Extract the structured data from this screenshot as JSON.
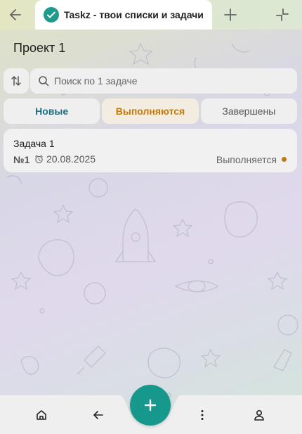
{
  "window": {
    "tab_title": "Taskz - твои списки и задачи",
    "logo_text": "Taskz",
    "accent": "#17988c"
  },
  "page": {
    "title": "Проект 1"
  },
  "search": {
    "placeholder": "Поиск по 1 задаче"
  },
  "filter_tabs": [
    {
      "label": "Новые",
      "color": "#1f6f80"
    },
    {
      "label": "Выполняются",
      "color": "#c07a10"
    },
    {
      "label": "Завершены",
      "color": "#555555"
    }
  ],
  "tasks": [
    {
      "name": "Задача 1",
      "number": "№1",
      "date": "20.08.2025",
      "status": "Выполняется",
      "status_color": "#c07a10"
    }
  ],
  "icons": {
    "back": "arrow-left-icon",
    "new_tab": "plus-icon",
    "minimize": "minimize-icon",
    "sort": "sort-icon",
    "search": "search-icon",
    "alarm": "alarm-icon",
    "home": "home-icon",
    "nav_back": "arrow-left-icon",
    "add": "plus-icon",
    "menu": "more-vertical-icon",
    "profile": "user-icon"
  }
}
